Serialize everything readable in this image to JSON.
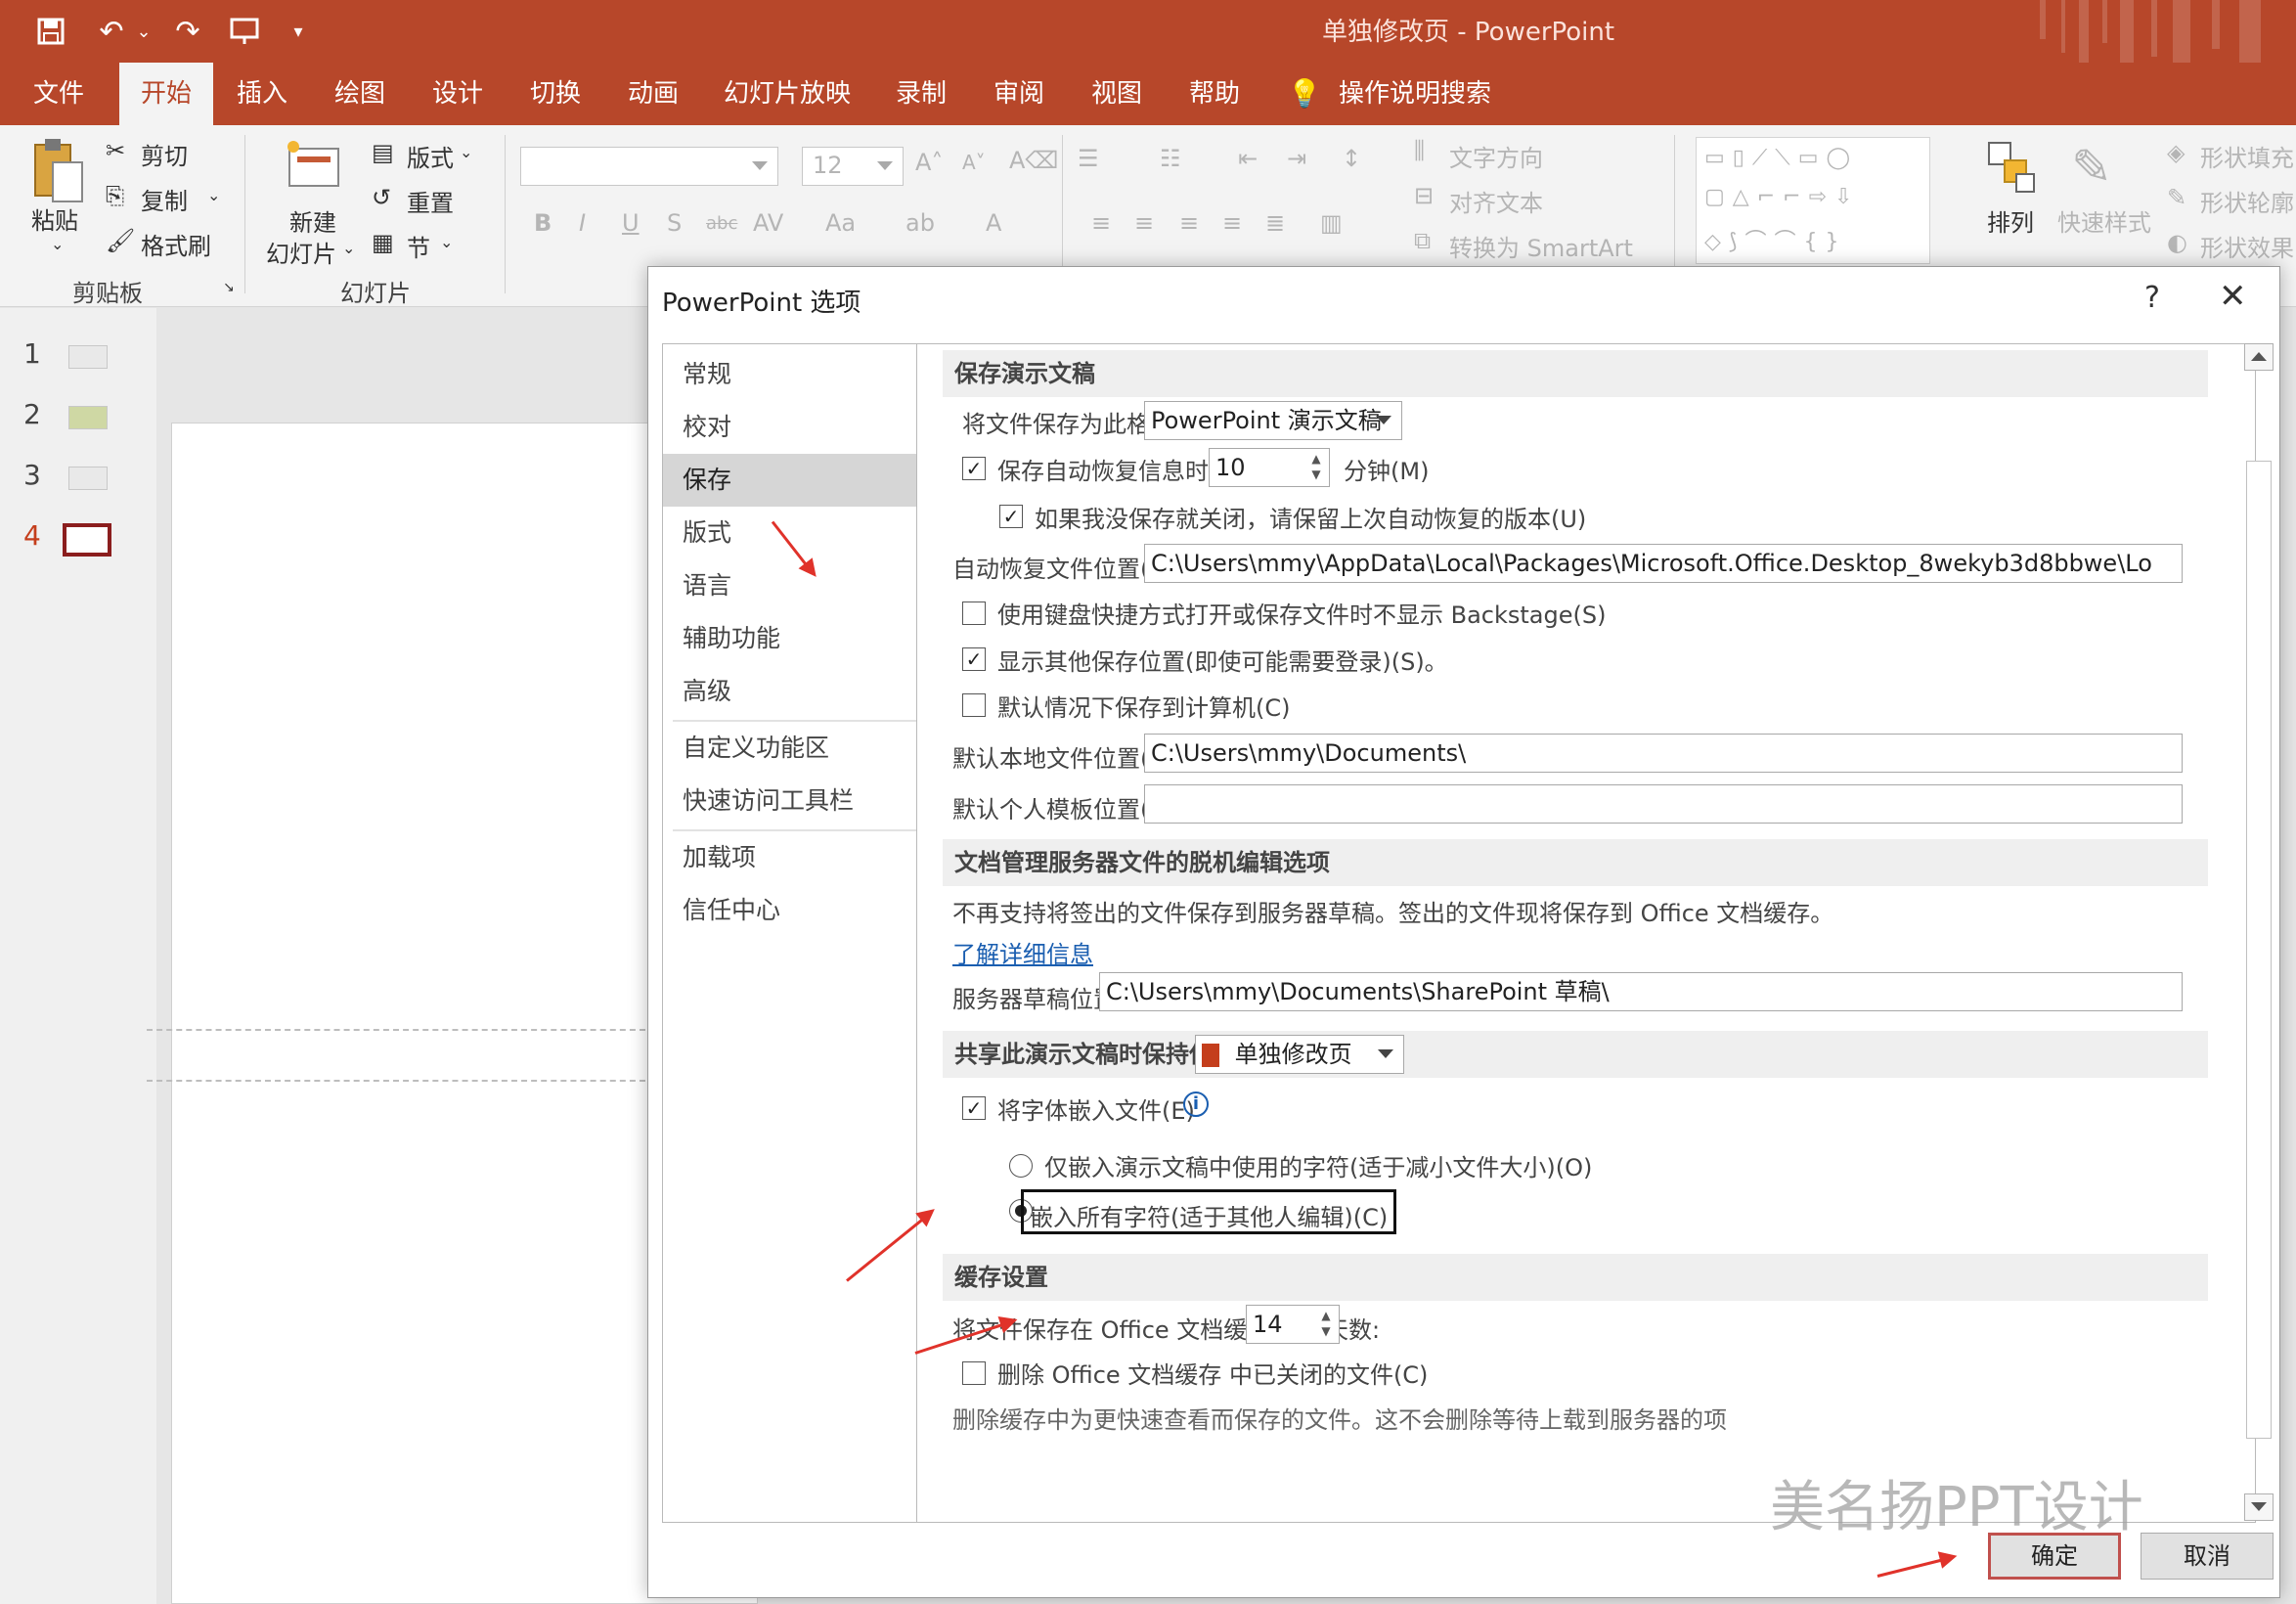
{
  "app": {
    "title": "单独修改页  -  PowerPoint"
  },
  "tabs": [
    "文件",
    "开始",
    "插入",
    "绘图",
    "设计",
    "切换",
    "动画",
    "幻灯片放映",
    "录制",
    "审阅",
    "视图",
    "帮助",
    "操作说明搜索"
  ],
  "ribbon": {
    "clipboard": {
      "paste": "粘贴",
      "cut": "剪切",
      "copy": "复制",
      "format_painter": "格式刷",
      "group": "剪贴板"
    },
    "slides": {
      "new_slide": "新建",
      "new_slide_2": "幻灯片",
      "layout": "版式",
      "reset": "重置",
      "section": "节",
      "group": "幻灯片"
    },
    "font": {
      "size_placeholder": "12"
    },
    "paragraph": {
      "text_direction": "文字方向",
      "align_text": "对齐文本",
      "smartart": "转换为 SmartArt"
    },
    "drawing": {
      "arrange": "排列",
      "quick_styles": "快速样式",
      "shape_fill": "形状填充",
      "shape_outline": "形状轮廓",
      "shape_effects": "形状效果"
    }
  },
  "thumbnails": [
    "1",
    "2",
    "3",
    "4"
  ],
  "dialog": {
    "title": "PowerPoint 选项",
    "help": "?",
    "nav": [
      "常规",
      "校对",
      "保存",
      "版式",
      "语言",
      "辅助功能",
      "高级",
      "自定义功能区",
      "快速访问工具栏",
      "加载项",
      "信任中心"
    ],
    "sections": {
      "save": "保存演示文稿",
      "offline": "文档管理服务器文件的脱机编辑选项",
      "fidelity": "共享此演示文稿时保持保真度(D):",
      "cache": "缓存设置"
    },
    "save": {
      "format_label": "将文件保存为此格式(F):",
      "format_value": "PowerPoint 演示文稿",
      "autorecover_label": "保存自动恢复信息时间间隔(A)",
      "autorecover_value": "10",
      "minutes": "分钟(M)",
      "keep_last": "如果我没保存就关闭，请保留上次自动恢复的版本(U)",
      "autorecover_path_label": "自动恢复文件位置(R):",
      "autorecover_path": "C:\\Users\\mmy\\AppData\\Local\\Packages\\Microsoft.Office.Desktop_8wekyb3d8bbwe\\Lo",
      "no_backstage": "使用键盘快捷方式打开或保存文件时不显示 Backstage(S)",
      "show_locations": "显示其他保存位置(即使可能需要登录)(S)。",
      "save_to_computer": "默认情况下保存到计算机(C)",
      "local_path_label": "默认本地文件位置(I):",
      "local_path": "C:\\Users\\mmy\\Documents\\",
      "template_path_label": "默认个人模板位置(T):",
      "template_path": ""
    },
    "offline": {
      "note": "不再支持将签出的文件保存到服务器草稿。签出的文件现将保存到 Office 文档缓存。",
      "learn_more": "了解详细信息",
      "drafts_label": "服务器草稿位置(V):",
      "drafts_path": "C:\\Users\\mmy\\Documents\\SharePoint 草稿\\"
    },
    "fidelity": {
      "doc": "单独修改页",
      "embed_fonts": "将字体嵌入文件(E)",
      "embed_used": "仅嵌入演示文稿中使用的字符(适于减小文件大小)(O)",
      "embed_all": "嵌入所有字符(适于其他人编辑)(C)"
    },
    "cache": {
      "days_label": "将文件保存在 Office 文档缓存 中的天数:",
      "days_value": "14",
      "delete_closed": "删除 Office 文档缓存 中已关闭的文件(C)",
      "cut_text": "删除缓存中为更快速查看而保存的文件。这不会删除等待上载到服务器的项"
    },
    "ok": "确定",
    "cancel": "取消"
  },
  "watermark": "美名扬PPT设计",
  "colors": {
    "accent": "#b7472a",
    "annotation": "#e0322a"
  }
}
